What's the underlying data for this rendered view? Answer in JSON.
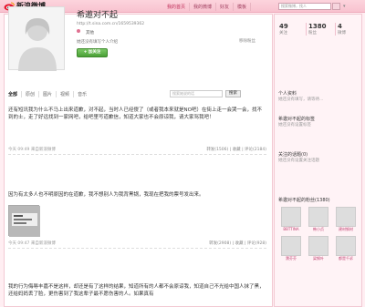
{
  "header": {
    "logo_text": "新浪微博",
    "logo_sub": "t.sina.com.cn",
    "nav": [
      "我的首页",
      "我的微博",
      "好友",
      "模板"
    ],
    "search_placeholder": "搜索微博，找人"
  },
  "profile": {
    "name": "希邀对不起",
    "url": "http://t.sina.com.cn/1659539362",
    "place": "其他",
    "intro": "她还没有填写个人介绍",
    "follow_label": "+ 加关注",
    "cancel_follow": "移除粉丝"
  },
  "tabs": {
    "items": [
      "全部",
      "原创",
      "图片",
      "视频",
      "音乐"
    ],
    "search_placeholder": "搜索她说的话",
    "search_button": "搜索"
  },
  "posts": [
    {
      "text": "还有短讯我为什么不马上出来道歉，对不起，当时人已经傻了（或者我本来就是NO吧）在街上走一会哭一会，找不到的士，走了好远找到一家网吧，给吧里写道歉信，知道大家也不会原谅我，请大家骂我吧！",
      "time": "今天 09:49",
      "via": "来自新浪微博",
      "actions": "转发(1506) | 收藏 | 评论(2184)"
    },
    {
      "text": "因为有太多人也不明原因的在道歉，我不想别人为我背黑锅，我现在把我的票号发出来。",
      "time": "今天 09:47",
      "via": "来自新浪微博",
      "actions": "转发(2908) | 收藏 | 评论(928)"
    },
    {
      "text": "我的行为侮辱丰嘉不是这样，却还是有了这样的结果，知道所有的人都不会原谅我，知道自己不光给中国人抹了黑，还给妈妈丢了脸，更伤害到了我这辈子最不愿伤害的人。如果真有"
    }
  ],
  "sidebar": {
    "stats": [
      {
        "num": "49",
        "label": "关注"
      },
      {
        "num": "1380",
        "label": "粉丝"
      },
      {
        "num": "4",
        "label": "微博"
      }
    ],
    "personal_info": "个人资料",
    "personal_info_text": "她还没有填写，请等待...",
    "tags_title": "希邀对不起的标签",
    "tags_text": "她还没有设置标签",
    "topics_title": "关注的话题(0)",
    "topics_text": "她还没有设置关注话题",
    "fans_title": "希邀对不起的粉丝(1380)",
    "fans": [
      "BBTTINA",
      "韩小贞",
      "建材钢材",
      "寶芬芬",
      "梁钢叶",
      "都是千诉"
    ]
  }
}
